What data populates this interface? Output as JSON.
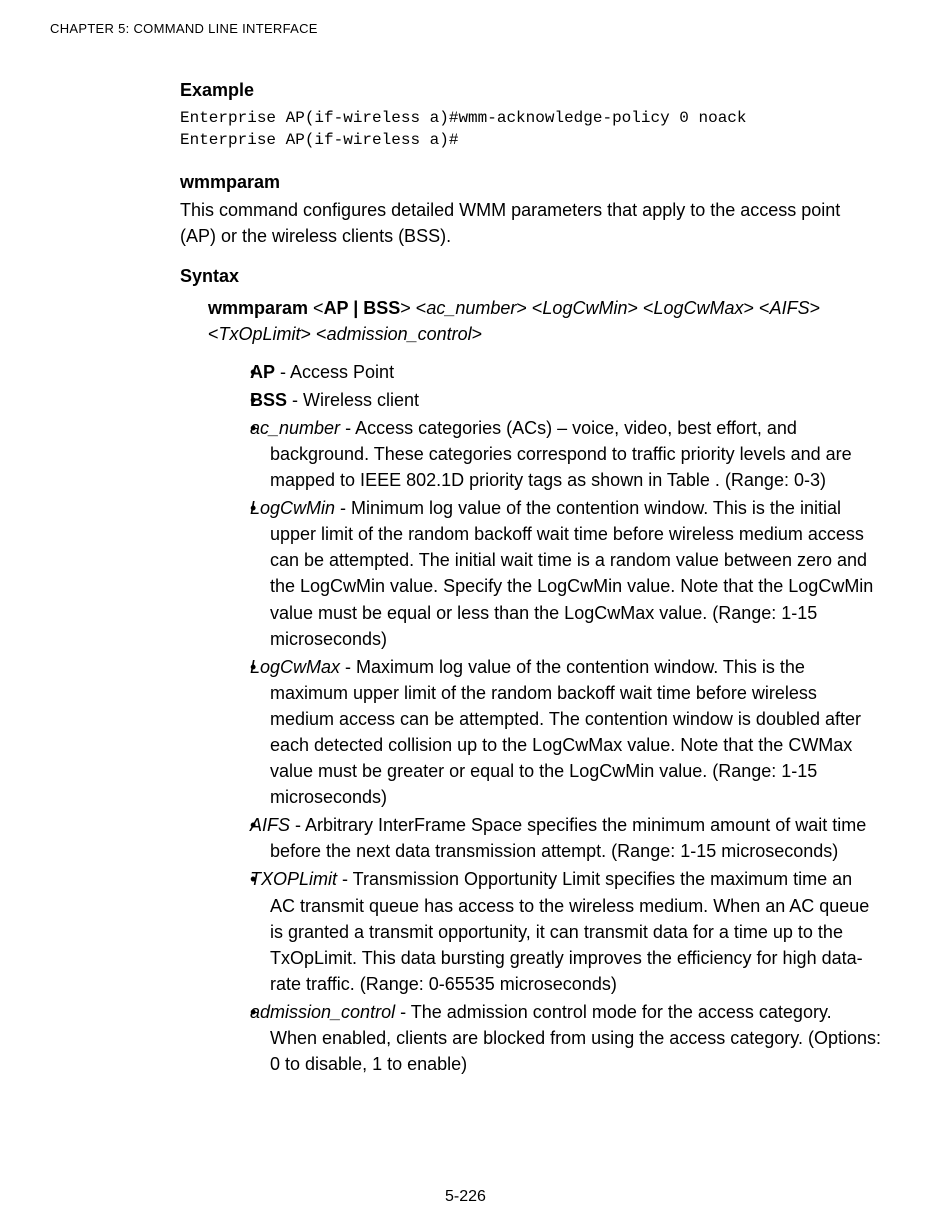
{
  "header": "CHAPTER 5: COMMAND LINE INTERFACE",
  "example": {
    "heading": "Example",
    "code": "Enterprise AP(if-wireless a)#wmm-acknowledge-policy 0 noack\nEnterprise AP(if-wireless a)#"
  },
  "command": {
    "name": "wmmparam",
    "desc": "This command configures detailed WMM parameters that apply to the access point (AP) or the wireless clients (BSS)."
  },
  "syntax": {
    "heading": "Syntax",
    "cmd_bold": "wmmparam",
    "open1": " <",
    "apbss_bold": "AP | BSS",
    "close1": "> <",
    "acnum_i": "ac_number",
    "close2": "> <",
    "logmin_i": "LogCwMin",
    "close3": "> <",
    "logmax_i": "LogCwMax",
    "close4": "> <",
    "aifs_i": "AIFS",
    "close5": "> <",
    "txop_i": "TxOpLimit",
    "close6": "> <",
    "adm_i": "admission_control",
    "close7": ">"
  },
  "bullets": {
    "ap": {
      "term": "AP",
      "desc": " - Access Point"
    },
    "bss": {
      "term": "BSS",
      "desc": " - Wireless client"
    },
    "acnum": {
      "term": "ac_number",
      "desc": " -  Access categories (ACs) – voice, video, best effort, and background. These categories correspond to traffic priority levels and are mapped to IEEE 802.1D priority tags as shown in Table . (Range: 0-3)"
    },
    "logmin": {
      "term": "LogCwMin",
      "desc": " - Minimum log value of the contention window. This is the initial upper limit of the random backoff wait time before wireless medium access can be attempted. The initial wait time is a random value between zero and the LogCwMin value. Specify the LogCwMin value. Note that the LogCwMin value must be equal or less than the LogCwMax value. (Range: 1-15 microseconds)"
    },
    "logmax": {
      "term": "LogCwMax",
      "desc": " - Maximum log value of the contention window. This is the maximum upper limit of the random backoff wait time before wireless medium access can be attempted. The contention window is doubled after each detected collision up to the LogCwMax value. Note that the CWMax value must be greater or equal to the LogCwMin value. (Range: 1-15 microseconds)"
    },
    "aifs": {
      "term": "AIFS",
      "desc": " - Arbitrary InterFrame Space specifies the minimum amount of wait time before the next data transmission attempt. (Range: 1-15 microseconds)"
    },
    "txop": {
      "term": "TXOPLimit",
      "desc": " - Transmission Opportunity  Limit specifies the maximum time an AC transmit queue has access to the wireless medium. When an AC queue is granted a transmit opportunity, it can transmit data for a time up to the TxOpLimit. This data bursting greatly improves the efficiency for high data-rate traffic. (Range: 0-65535 microseconds)"
    },
    "adm": {
      "term": "admission_control",
      "desc": " - The admission control mode for the access category. When enabled, clients are blocked from using the access category. (Options: 0 to disable, 1 to enable)"
    }
  },
  "page_number": "5-226"
}
